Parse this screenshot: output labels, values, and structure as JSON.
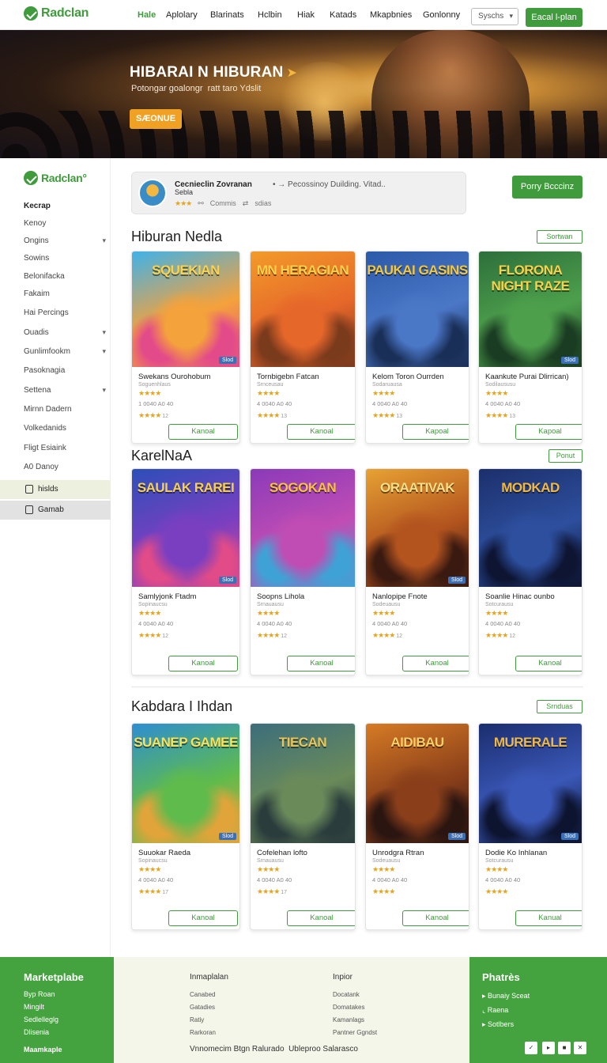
{
  "brand": {
    "name": "Radclan",
    "sidebar_name": "Radclan°"
  },
  "topnav": {
    "items": [
      "Hale",
      "Aplolary",
      "Blarinats",
      "Hclbin",
      "Hiak",
      "Katads",
      "Mkapbnies",
      "Gonlonny"
    ],
    "select_value": "Syschs",
    "cta": "Eacal l-plan"
  },
  "hero": {
    "title": "HIBARAI N HIBURAN",
    "subtitle": "Potongar goalongr  ratt taro Ydslit",
    "button": "SÆONUE"
  },
  "sidebar": {
    "heading": "Kecrap",
    "items": [
      {
        "label": "Kenoy",
        "chev": false
      },
      {
        "label": "Ongins",
        "chev": true
      },
      {
        "label": "Sowins",
        "chev": false
      },
      {
        "label": "Belonifacka",
        "chev": false
      },
      {
        "label": "Fakaim",
        "chev": false
      },
      {
        "label": "Hai Percings",
        "chev": false
      },
      {
        "label": "Ouadis",
        "chev": true
      },
      {
        "label": "Gunlimfookm",
        "chev": true
      },
      {
        "label": "Pasoknagia",
        "chev": false
      },
      {
        "label": "Settena",
        "chev": true
      },
      {
        "label": "Mirnn Dadern",
        "chev": false
      },
      {
        "label": "Volkedanids",
        "chev": false
      },
      {
        "label": "Fligt Esiaink",
        "chev": false
      },
      {
        "label": "A0 Danoy",
        "chev": false
      }
    ],
    "highlight1": "hislds",
    "highlight2": "Gamab"
  },
  "info_card": {
    "title": "Cecnieclin Zovranan",
    "title_suffix": "• → Pecossinoy Duilding. Vitad..",
    "subtitle": "Sebla",
    "stars": "★★★",
    "meta1": "Commis",
    "meta2": "sdias"
  },
  "cta_right": "Porry Bcccinz",
  "sections": [
    {
      "title": "Hiburan Nedla",
      "link": "Sortwan"
    },
    {
      "title": "KarelNaA",
      "link": "Ponut"
    },
    {
      "title": "Kabdara I Ihdan",
      "link": "Srnduas"
    }
  ],
  "cards": [
    [
      {
        "art": "SQUEKIAN",
        "name": "Swekans Ourohobum",
        "sub": "Soguenhlaus",
        "stars": "★★★★",
        "meta": "1 0040 A0 40",
        "stars2": "★★★★",
        "stars2_n": "12",
        "badge": "Slod",
        "button": "Kanoal"
      },
      {
        "art": "MN HERAGIAN",
        "name": "Tornbigebn Fatcan",
        "sub": "Srnceusau",
        "stars": "★★★★",
        "meta": "4 0040 A0 40",
        "stars2": "★★★★",
        "stars2_n": "13",
        "badge": "",
        "button": "Kanoal"
      },
      {
        "art": "PAUKAI GASINS",
        "name": "Kelom Toron Ourrden",
        "sub": "Sodaruausa",
        "stars": "★★★★",
        "meta": "4 0040 A0 40",
        "stars2": "★★★★",
        "stars2_n": "13",
        "badge": "",
        "button": "Kapoal"
      },
      {
        "art": "FLORONA NIGHT RAZE",
        "name": "Kaankute Purai Dlirrican)",
        "sub": "Sodilaususu",
        "stars": "★★★★",
        "meta": "4 0040 A0 40",
        "stars2": "★★★★",
        "stars2_n": "13",
        "badge": "Slod",
        "button": "Kapoal"
      }
    ],
    [
      {
        "art": "SAULAK RAREI",
        "name": "Samlyjonk Ftadm",
        "sub": "Sopinaucsu",
        "stars": "★★★★",
        "meta": "4 0040 A0 40",
        "stars2": "★★★★",
        "stars2_n": "12",
        "badge": "Slod",
        "button": "Kanoal"
      },
      {
        "art": "SOGOKAN",
        "name": "Soopns Lihola",
        "sub": "Srnauausu",
        "stars": "★★★★",
        "meta": "4 0040 A0 40",
        "stars2": "★★★★",
        "stars2_n": "12",
        "badge": "",
        "button": "Kanoal"
      },
      {
        "art": "ORAATIVAK",
        "name": "Nanlopipe Fnote",
        "sub": "Sodeuausu",
        "stars": "★★★★",
        "meta": "4 0040 A0 40",
        "stars2": "★★★★",
        "stars2_n": "12",
        "badge": "Slod",
        "button": "Kanoal"
      },
      {
        "art": "MODKAD",
        "name": "Soanlie Hinac ounbo",
        "sub": "Sotcurausu",
        "stars": "★★★★",
        "meta": "4 0040 A0 40",
        "stars2": "★★★★",
        "stars2_n": "12",
        "badge": "",
        "button": "Kanoal"
      }
    ],
    [
      {
        "art": "SUANEP GAMEE",
        "name": "Suuokar Raeda",
        "sub": "Sopinaucsu",
        "stars": "★★★★",
        "meta": "4 0040 A0 40",
        "stars2": "★★★★",
        "stars2_n": "17",
        "badge": "Slod",
        "button": "Kanoal"
      },
      {
        "art": "TIECAN",
        "name": "Cofelehan lofto",
        "sub": "Srnauausu",
        "stars": "★★★★",
        "meta": "4 0040 A0 40",
        "stars2": "★★★★",
        "stars2_n": "17",
        "badge": "",
        "button": "Kanoal"
      },
      {
        "art": "AIDIBAU",
        "name": "Unrodgra Rtran",
        "sub": "Sodeuausu",
        "stars": "★★★★",
        "meta": "4 0040 A0 40",
        "stars2": "★★★★",
        "stars2_n": "",
        "badge": "Slod",
        "button": "Kanoal"
      },
      {
        "art": "MURERALE",
        "name": "Dodie Ko Inhlanan",
        "sub": "Sotcurausu",
        "stars": "★★★★",
        "meta": "4 0040 A0 40",
        "stars2": "★★★★",
        "stars2_n": "",
        "badge": "Slod",
        "button": "Kanual"
      }
    ]
  ],
  "footer": {
    "left_title": "Marketplabe",
    "left_links": [
      "Byp Roan",
      "Mingilt",
      "Sedlelleglg",
      "Dlisenia"
    ],
    "left_bottom": "Maamkaple",
    "col1_title": "Inmaplalan",
    "col1_links": [
      "Canabed",
      "Gatadies",
      "Ratiy",
      "Rarkoran"
    ],
    "col2_title": "Inpior",
    "col2_links": [
      "Docatank",
      "Domatakes",
      "Kamanlags",
      "Pantner Ggndst"
    ],
    "bottom_text": "Vnnomecim Btgn Ralurado  Ubleproo Salarasco",
    "right_title": "Phatrès",
    "right_links": [
      "Bunaiy Sceat",
      "Raena",
      "Sotlbers"
    ],
    "social": [
      "✓",
      "▸",
      "■",
      "✕"
    ]
  },
  "colors": {
    "accent": "#3f9b3c",
    "star": "#e8a31d",
    "hero_btn": "#f0a124"
  }
}
